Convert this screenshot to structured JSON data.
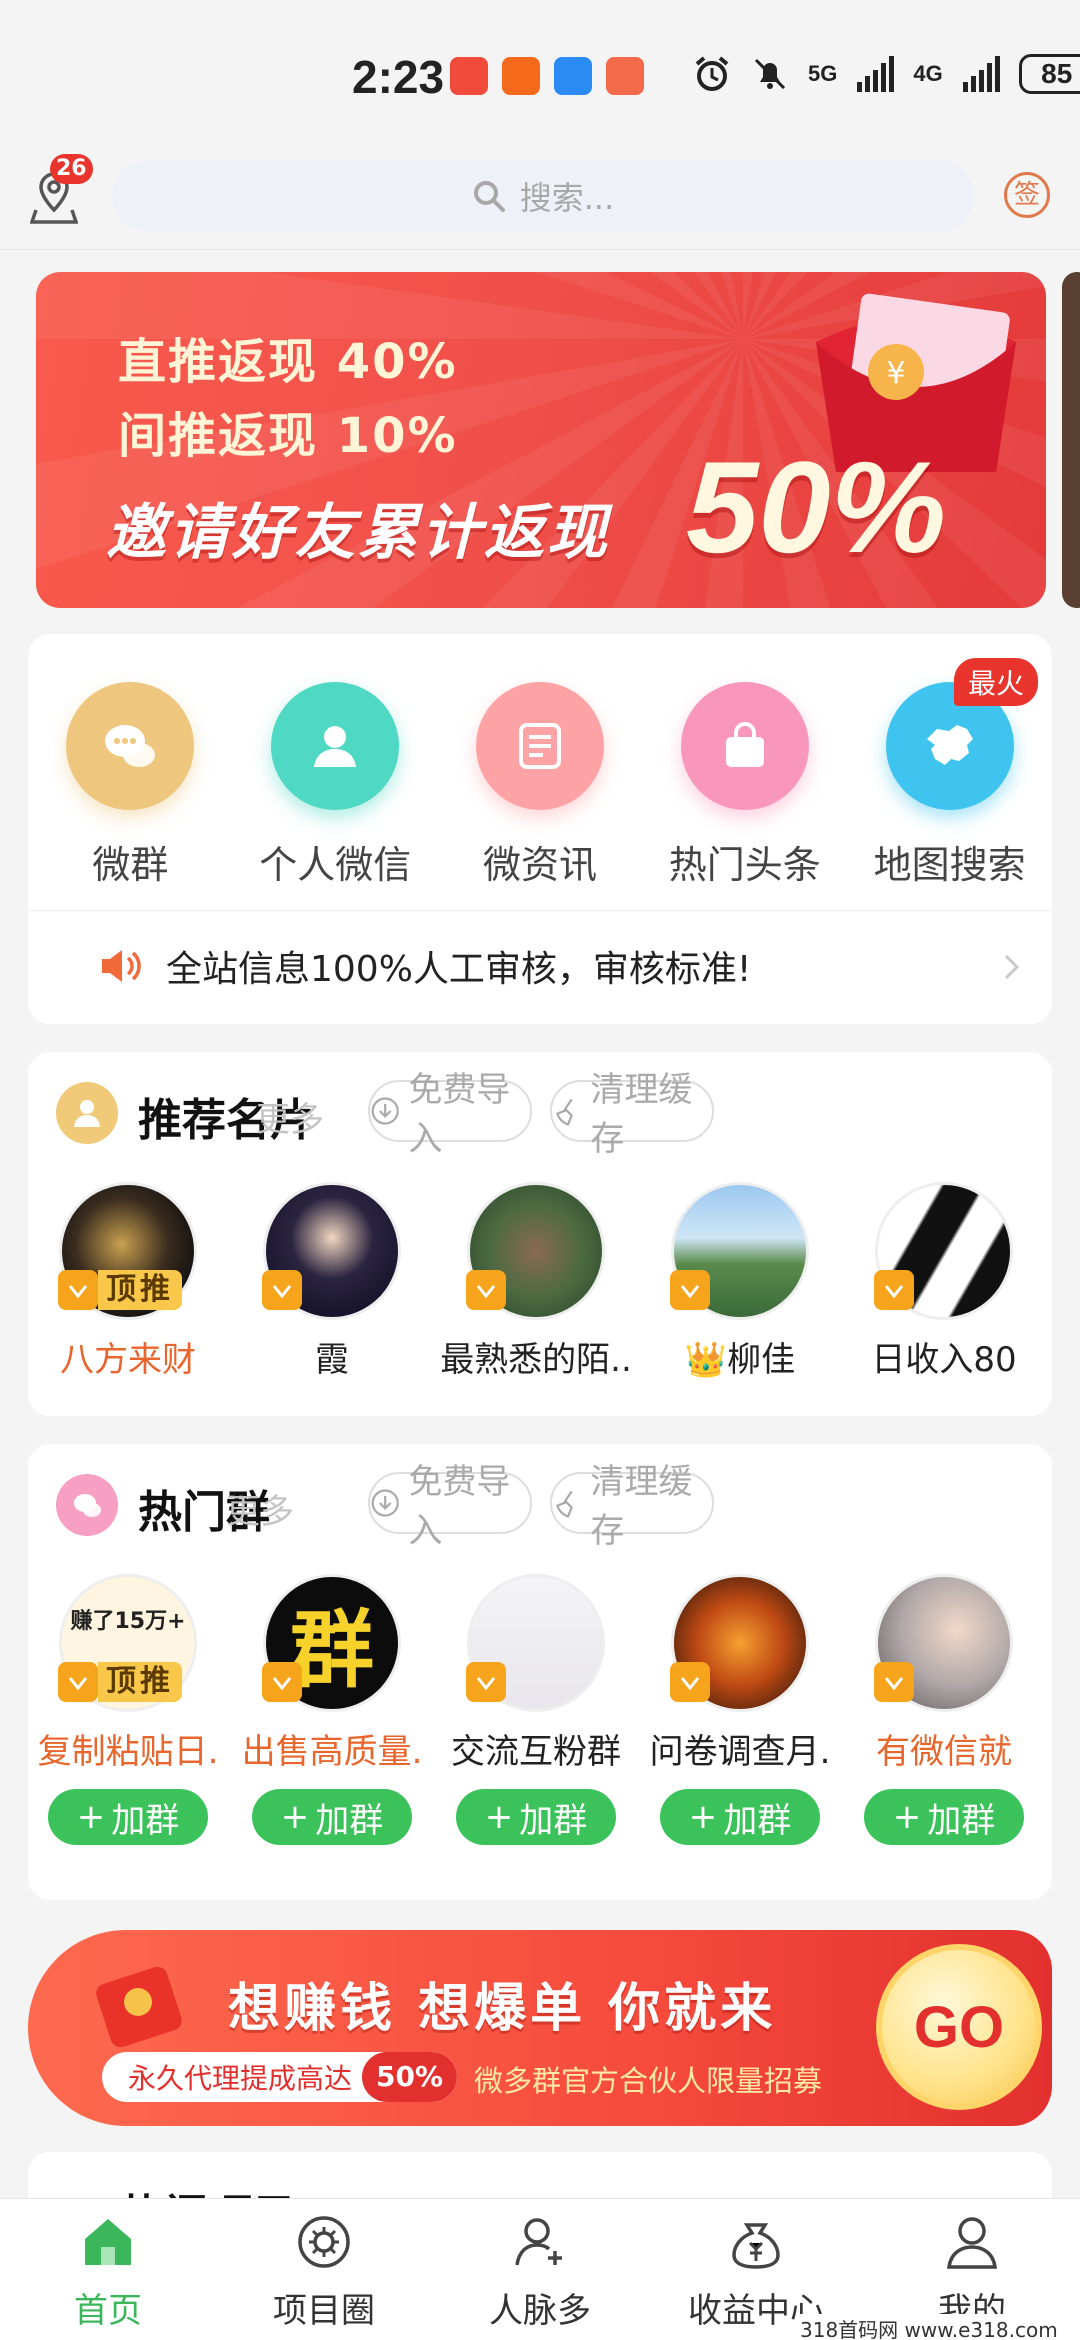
{
  "status_bar": {
    "time": "2:23",
    "signal_1": "5G",
    "signal_2": "4G",
    "battery": "85"
  },
  "header": {
    "location_badge": "26",
    "search_placeholder": "搜索...",
    "sign_label": "签"
  },
  "banner": {
    "line1": "直推返现 40%",
    "line2": "间推返现 10%",
    "main": "邀请好友累计返现",
    "percent": "50%"
  },
  "menu": {
    "items": [
      {
        "label": "微群",
        "icon": "chat-bubbles-icon",
        "color": "#eec67e"
      },
      {
        "label": "个人微信",
        "icon": "person-icon",
        "color": "#4fd8c4"
      },
      {
        "label": "微资讯",
        "icon": "document-icon",
        "color": "#fda3a6"
      },
      {
        "label": "热门头条",
        "icon": "shopping-bag-icon",
        "color": "#f896bb"
      },
      {
        "label": "地图搜索",
        "icon": "china-map-icon",
        "color": "#3ec4ee"
      }
    ],
    "hot_badge": "最火"
  },
  "notice": {
    "text": "全站信息100%人工审核，审核标准!"
  },
  "recommended_cards": {
    "title": "推荐名片",
    "more": "更多",
    "import_label": "免费导入",
    "clear_label": "清理缓存",
    "tag": "顶推",
    "items": [
      {
        "name": "八方来财",
        "highlight": true
      },
      {
        "name": "霞",
        "highlight": false
      },
      {
        "name": "最熟悉的陌..",
        "highlight": false
      },
      {
        "name": "👑柳佳",
        "highlight": false
      },
      {
        "name": "日收入80",
        "highlight": false
      }
    ]
  },
  "hot_groups": {
    "title": "热门群",
    "more": "更多",
    "import_label": "免费导入",
    "clear_label": "清理缓存",
    "tag": "顶推",
    "join_label": "加群",
    "items": [
      {
        "name": "复制粘贴日.",
        "highlight": true,
        "pic_text": "赚了15万+"
      },
      {
        "name": "出售高质量.",
        "highlight": true,
        "pic_text": "群"
      },
      {
        "name": "交流互粉群",
        "highlight": false
      },
      {
        "name": "问卷调查月.",
        "highlight": false
      },
      {
        "name": "有微信就",
        "highlight": true
      }
    ]
  },
  "promo": {
    "title": "想赚钱 想爆单 你就来",
    "pill_text": "永久代理提成高达",
    "pill_pct": "50%",
    "subtitle": "微多群官方合伙人限量招募",
    "go": "GO"
  },
  "partial_section": {
    "title": "热门项目"
  },
  "tabbar": {
    "items": [
      {
        "label": "首页",
        "active": true
      },
      {
        "label": "项目圈",
        "active": false
      },
      {
        "label": "人脉多",
        "active": false
      },
      {
        "label": "收益中心",
        "active": false
      },
      {
        "label": "我的",
        "active": false
      }
    ]
  },
  "watermark": "318首码网 www.e318.com"
}
